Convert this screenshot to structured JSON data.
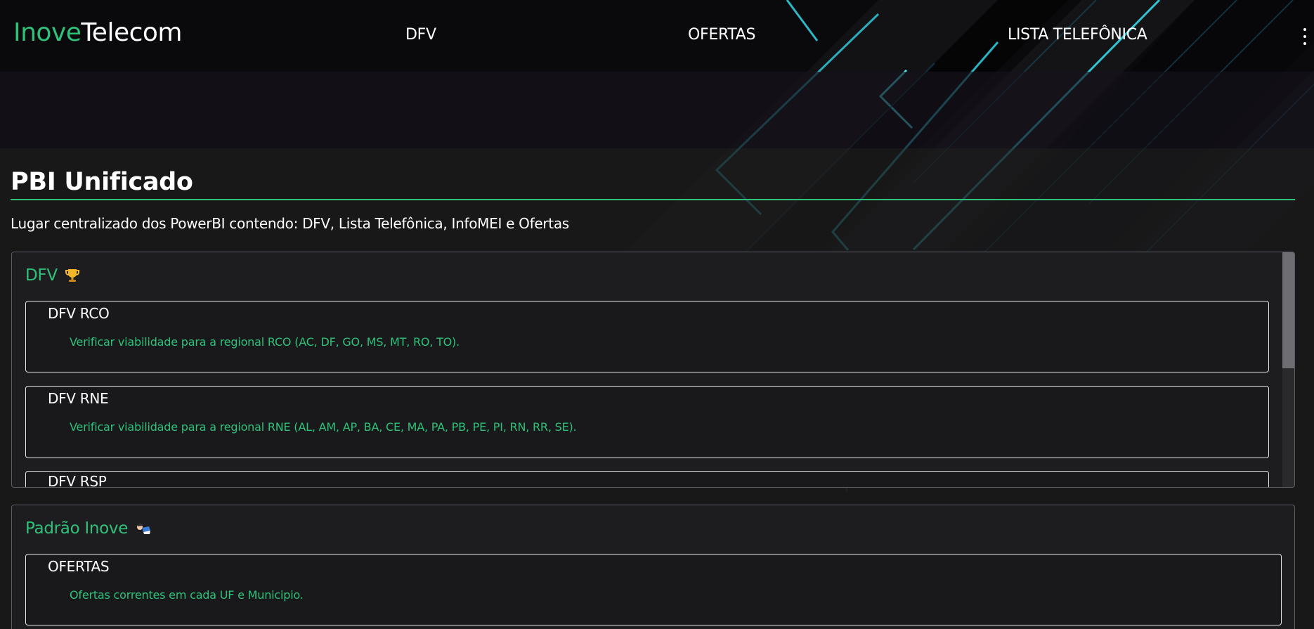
{
  "brand": {
    "part1": "Inove",
    "part2": "Telecom"
  },
  "nav": {
    "links": [
      {
        "label": "DFV"
      },
      {
        "label": "OFERTAS"
      },
      {
        "label": "LISTA TELEFÔNICA"
      }
    ],
    "menu_icon": "kebab-vertical-icon"
  },
  "page": {
    "title": "PBI Unificado",
    "description": "Lugar centralizado dos PowerBI contendo: DFV, Lista Telefônica, InfoMEI e Ofertas"
  },
  "sections": [
    {
      "title": "DFV",
      "icon": "trophy-icon",
      "items": [
        {
          "title": "DFV RCO",
          "description": "Verificar viabilidade para a regional RCO (AC, DF, GO, MS, MT, RO, TO)."
        },
        {
          "title": "DFV RNE",
          "description": "Verificar viabilidade para a regional RNE (AL, AM, AP, BA, CE, MA, PA, PB, PE, PI, RN, RR, SE)."
        },
        {
          "title": "DFV RSP",
          "description": ""
        }
      ]
    },
    {
      "title": "Padrão Inove",
      "icon": "bowing-person-icon",
      "items": [
        {
          "title": "OFERTAS",
          "description": "Ofertas correntes em cada UF e Municipio."
        }
      ]
    }
  ],
  "colors": {
    "accent": "#2fc17a",
    "background": "#0a090c",
    "panel": "#1d1d1f",
    "neon": "#35d6e6"
  }
}
